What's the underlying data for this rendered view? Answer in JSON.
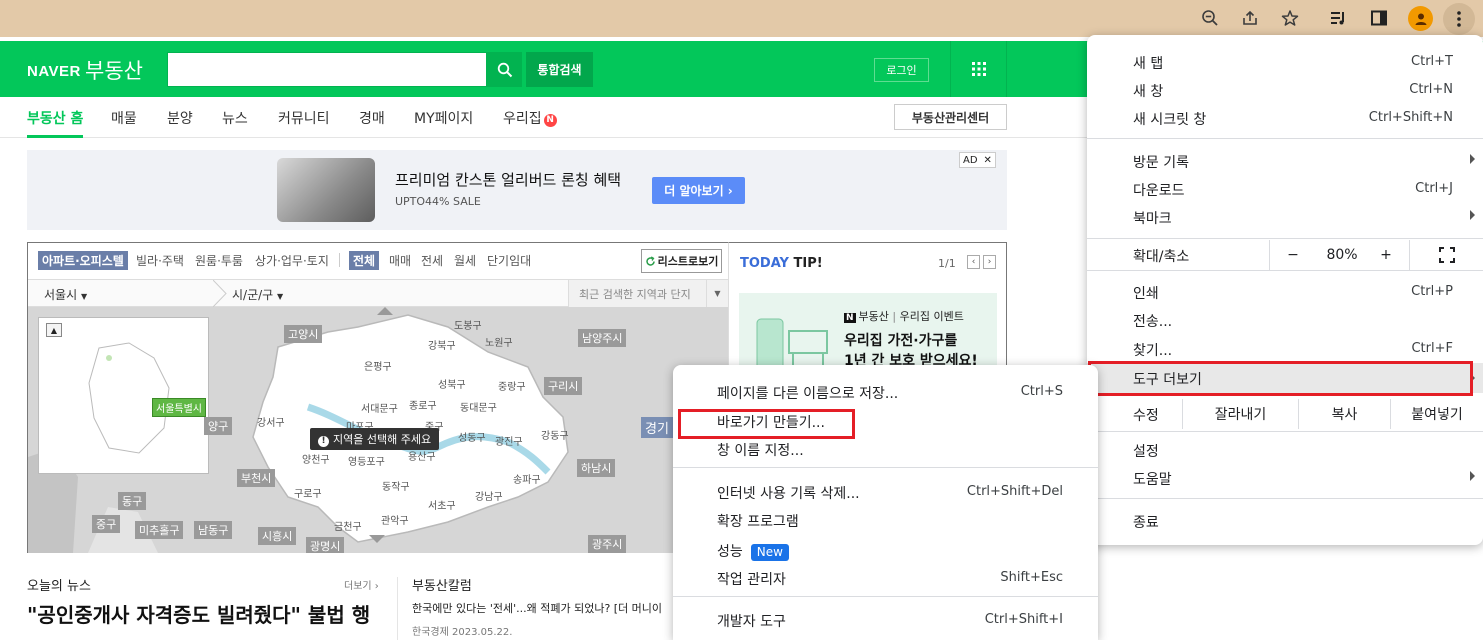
{
  "naver": {
    "logo_naver": "NAVER",
    "logo_bds": "부동산",
    "search_button": "통합검색",
    "login": "로그인",
    "nav": [
      {
        "label": "부동산 홈"
      },
      {
        "label": "매물"
      },
      {
        "label": "분양"
      },
      {
        "label": "뉴스"
      },
      {
        "label": "커뮤니티"
      },
      {
        "label": "경매"
      },
      {
        "label": "MY페이지"
      },
      {
        "label": "우리집"
      }
    ],
    "nav_badge": "N",
    "mgmt_center": "부동산관리센터"
  },
  "ad": {
    "title": "프리미엄 칸스톤 얼리버드 론칭 혜택",
    "subtitle": "UPTO44% SALE",
    "cta": "더 알아보기 ›",
    "tag": "AD",
    "close": "✕"
  },
  "map": {
    "tabs_type": [
      "아파트·오피스텔",
      "빌라·주택",
      "원룸·투룸",
      "상가·업무·토지"
    ],
    "tabs_deal": [
      "전체",
      "매매",
      "전세",
      "월세",
      "단기임대"
    ],
    "list_button": "리스트로보기",
    "city": "서울시",
    "gu": "시/군/구",
    "recent": "최근 검색한 지역과 단지",
    "prompt": "지역을 선택해 주세요",
    "seoul_tag": "서울특별시",
    "labels_box": [
      "고양시",
      "남양주시",
      "구리시",
      "하남시",
      "부천시",
      "양구",
      "동구",
      "중구",
      "미추홀구",
      "남동구",
      "시흥시",
      "광명시",
      "광주시",
      "경기"
    ],
    "gu_labels": [
      "도봉구",
      "강북구",
      "노원구",
      "은평구",
      "성북구",
      "중랑구",
      "서대문구",
      "종로구",
      "동대문구",
      "마포구",
      "중구",
      "강서구",
      "성동구",
      "광진구",
      "강동구",
      "양천구",
      "영등포구",
      "용산구",
      "구로구",
      "동작구",
      "서초구",
      "강남구",
      "송파구",
      "관악구",
      "금천구"
    ]
  },
  "tip": {
    "today": "TODAY",
    "tip": "TIP!",
    "count": "1/1",
    "prev": "‹",
    "next": "›",
    "brand": "부동산",
    "event": "우리집 이벤트",
    "headline1": "우리집 가전·가구를",
    "headline2": "1년 간 보호 받으세요!"
  },
  "news": {
    "title": "오늘의 뉴스",
    "more": "더보기 ›",
    "headline": "\"공인중개사 자격증도 빌려줬다\" 불법 행",
    "column_title": "부동산칼럼",
    "column_item": "한국에만 있다는 '전세'...왜 적폐가 되었나? [더 머니이",
    "column_meta": "한국경제 2023.05.22."
  },
  "chrome_menu": {
    "items_top": [
      {
        "label": "새 탭",
        "shortcut": "Ctrl+T"
      },
      {
        "label": "새 창",
        "shortcut": "Ctrl+N"
      },
      {
        "label": "새 시크릿 창",
        "shortcut": "Ctrl+Shift+N"
      }
    ],
    "items_mid": [
      {
        "label": "방문 기록",
        "shortcut": ""
      },
      {
        "label": "다운로드",
        "shortcut": "Ctrl+J"
      },
      {
        "label": "북마크",
        "shortcut": ""
      }
    ],
    "zoom_label": "확대/축소",
    "zoom_minus": "−",
    "zoom_value": "80%",
    "zoom_plus": "+",
    "items_tools": [
      {
        "label": "인쇄",
        "shortcut": "Ctrl+P"
      },
      {
        "label": "전송...",
        "shortcut": ""
      },
      {
        "label": "찾기...",
        "shortcut": "Ctrl+F"
      },
      {
        "label": "도구 더보기",
        "shortcut": ""
      }
    ],
    "edit_label": "수정",
    "edit_cut": "잘라내기",
    "edit_copy": "복사",
    "edit_paste": "붙여넣기",
    "items_bottom": [
      {
        "label": "설정",
        "shortcut": ""
      },
      {
        "label": "도움말",
        "shortcut": ""
      }
    ],
    "exit": "종료"
  },
  "sub_menu": {
    "save_as": {
      "label": "페이지를 다른 이름으로 저장...",
      "shortcut": "Ctrl+S"
    },
    "shortcut": {
      "label": "바로가기 만들기..."
    },
    "name_window": {
      "label": "창 이름 지정..."
    },
    "clear_history": {
      "label": "인터넷 사용 기록 삭제...",
      "shortcut": "Ctrl+Shift+Del"
    },
    "extensions": {
      "label": "확장 프로그램"
    },
    "performance": {
      "label": "성능",
      "badge": "New"
    },
    "task_manager": {
      "label": "작업 관리자",
      "shortcut": "Shift+Esc"
    },
    "dev_tools": {
      "label": "개발자 도구",
      "shortcut": "Ctrl+Shift+I"
    }
  }
}
